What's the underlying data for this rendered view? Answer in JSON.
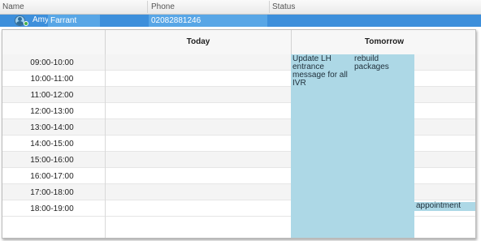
{
  "table": {
    "columns": {
      "name": "Name",
      "phone": "Phone",
      "status": "Status"
    },
    "row": {
      "first_name": "Amy",
      "last_name": "Farrant",
      "phone": "02082881246",
      "status": ""
    }
  },
  "calendar": {
    "days": [
      "Today",
      "Tomorrow"
    ],
    "time_slots": [
      "09:00-10:00",
      "10:00-11:00",
      "11:00-12:00",
      "12:00-13:00",
      "13:00-14:00",
      "14:00-15:00",
      "15:00-16:00",
      "16:00-17:00",
      "17:00-18:00",
      "18:00-19:00"
    ],
    "events": [
      {
        "label": "Update LH entrance message for all IVR",
        "day": "Tomorrow"
      },
      {
        "label": "rebuild packages",
        "day": "Tomorrow"
      },
      {
        "label": "appointment",
        "day": "Tomorrow",
        "slot": "17:00-18:00"
      }
    ]
  },
  "colors": {
    "selection": "#3d8fdb",
    "selection_highlight": "#58a6e6",
    "event": "#add8e6",
    "status_online": "#44b04a"
  }
}
